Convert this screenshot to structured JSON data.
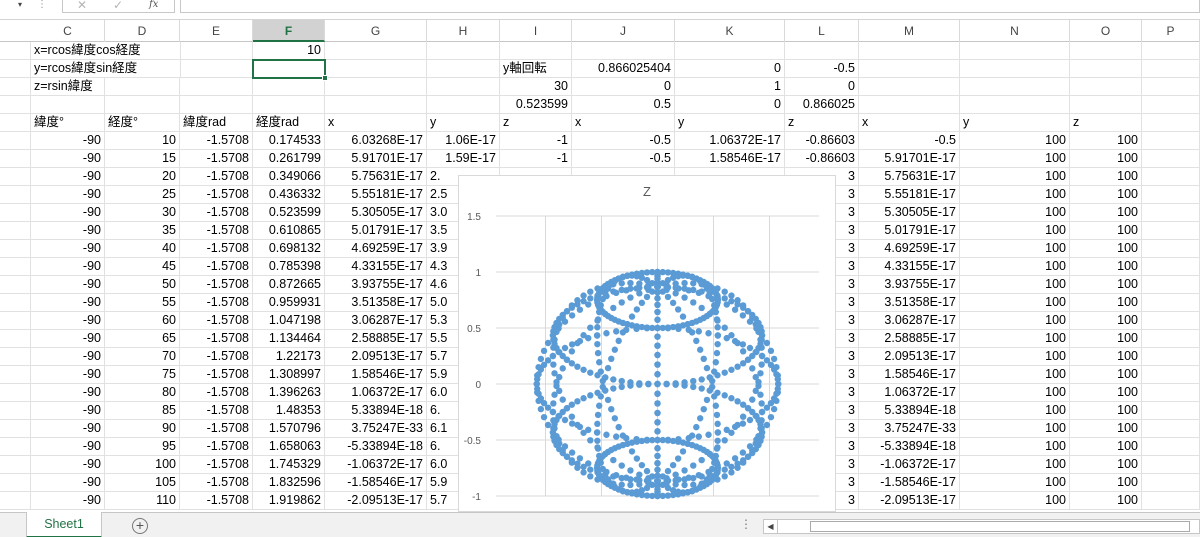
{
  "formula_bar": {
    "name_box_arrow": "▾",
    "separator": "⋮",
    "cancel_icon": "✕",
    "enter_icon": "✓",
    "fx_label": "fx",
    "formula_value": ""
  },
  "columns": [
    "C",
    "D",
    "E",
    "F",
    "G",
    "H",
    "I",
    "J",
    "K",
    "L",
    "M",
    "N",
    "O",
    "P"
  ],
  "selected_column": "F",
  "rows": [
    [
      {
        "t": "x=rcos緯度cos経度",
        "a": "l",
        "c": 0
      },
      {
        "t": "10",
        "a": "r",
        "c": 3
      }
    ],
    [
      {
        "t": "y=rcos緯度sin経度",
        "a": "l",
        "c": 0
      },
      {
        "t": "y軸回転",
        "a": "l",
        "c": 6
      },
      {
        "t": "0.866025404",
        "a": "r",
        "c": 7
      },
      {
        "t": "0",
        "a": "r",
        "c": 8
      },
      {
        "t": "-0.5",
        "a": "r",
        "c": 9
      }
    ],
    [
      {
        "t": "z=rsin緯度",
        "a": "l",
        "c": 0
      },
      {
        "t": "30",
        "a": "r",
        "c": 6
      },
      {
        "t": "0",
        "a": "r",
        "c": 7
      },
      {
        "t": "1",
        "a": "r",
        "c": 8
      },
      {
        "t": "0",
        "a": "r",
        "c": 9
      }
    ],
    [
      {
        "t": "0.523599",
        "a": "r",
        "c": 6
      },
      {
        "t": "0.5",
        "a": "r",
        "c": 7
      },
      {
        "t": "0",
        "a": "r",
        "c": 8
      },
      {
        "t": "0.866025",
        "a": "r",
        "c": 9
      }
    ],
    [
      {
        "t": "緯度°",
        "a": "l",
        "c": 0
      },
      {
        "t": "経度°",
        "a": "l",
        "c": 1
      },
      {
        "t": "緯度rad",
        "a": "l",
        "c": 2
      },
      {
        "t": "経度rad",
        "a": "l",
        "c": 3
      },
      {
        "t": "x",
        "a": "l",
        "c": 4
      },
      {
        "t": "y",
        "a": "l",
        "c": 5
      },
      {
        "t": "z",
        "a": "l",
        "c": 6
      },
      {
        "t": "x",
        "a": "l",
        "c": 7
      },
      {
        "t": "y",
        "a": "l",
        "c": 8
      },
      {
        "t": "z",
        "a": "l",
        "c": 9
      },
      {
        "t": "x",
        "a": "l",
        "c": 10
      },
      {
        "t": "y",
        "a": "l",
        "c": 11
      },
      {
        "t": "z",
        "a": "l",
        "c": 12
      }
    ],
    [
      {
        "t": "-90",
        "a": "r",
        "c": 0
      },
      {
        "t": "10",
        "a": "r",
        "c": 1
      },
      {
        "t": "-1.5708",
        "a": "r",
        "c": 2
      },
      {
        "t": "0.174533",
        "a": "r",
        "c": 3
      },
      {
        "t": "6.03268E-17",
        "a": "r",
        "c": 4
      },
      {
        "t": "1.06E-17",
        "a": "r",
        "c": 5
      },
      {
        "t": "-1",
        "a": "r",
        "c": 6
      },
      {
        "t": "-0.5",
        "a": "r",
        "c": 7
      },
      {
        "t": "1.06372E-17",
        "a": "r",
        "c": 8
      },
      {
        "t": "-0.86603",
        "a": "r",
        "c": 9
      },
      {
        "t": "-0.5",
        "a": "r",
        "c": 10
      },
      {
        "t": "100",
        "a": "r",
        "c": 11
      },
      {
        "t": "100",
        "a": "r",
        "c": 12
      }
    ],
    [
      {
        "t": "-90",
        "a": "r",
        "c": 0
      },
      {
        "t": "15",
        "a": "r",
        "c": 1
      },
      {
        "t": "-1.5708",
        "a": "r",
        "c": 2
      },
      {
        "t": "0.261799",
        "a": "r",
        "c": 3
      },
      {
        "t": "5.91701E-17",
        "a": "r",
        "c": 4
      },
      {
        "t": "1.59E-17",
        "a": "r",
        "c": 5
      },
      {
        "t": "-1",
        "a": "r",
        "c": 6
      },
      {
        "t": "-0.5",
        "a": "r",
        "c": 7
      },
      {
        "t": "1.58546E-17",
        "a": "r",
        "c": 8
      },
      {
        "t": "-0.86603",
        "a": "r",
        "c": 9
      },
      {
        "t": "5.91701E-17",
        "a": "r",
        "c": 10
      },
      {
        "t": "100",
        "a": "r",
        "c": 11
      },
      {
        "t": "100",
        "a": "r",
        "c": 12
      }
    ],
    [
      {
        "t": "-90",
        "a": "r",
        "c": 0
      },
      {
        "t": "20",
        "a": "r",
        "c": 1
      },
      {
        "t": "-1.5708",
        "a": "r",
        "c": 2
      },
      {
        "t": "0.349066",
        "a": "r",
        "c": 3
      },
      {
        "t": "5.75631E-17",
        "a": "r",
        "c": 4
      },
      {
        "t": "2.",
        "a": "l",
        "c": 5
      },
      {
        "t": "3",
        "a": "r",
        "c": 9
      },
      {
        "t": "5.75631E-17",
        "a": "r",
        "c": 10
      },
      {
        "t": "100",
        "a": "r",
        "c": 11
      },
      {
        "t": "100",
        "a": "r",
        "c": 12
      }
    ],
    [
      {
        "t": "-90",
        "a": "r",
        "c": 0
      },
      {
        "t": "25",
        "a": "r",
        "c": 1
      },
      {
        "t": "-1.5708",
        "a": "r",
        "c": 2
      },
      {
        "t": "0.436332",
        "a": "r",
        "c": 3
      },
      {
        "t": "5.55181E-17",
        "a": "r",
        "c": 4
      },
      {
        "t": "2.5",
        "a": "l",
        "c": 5
      },
      {
        "t": "3",
        "a": "r",
        "c": 9
      },
      {
        "t": "5.55181E-17",
        "a": "r",
        "c": 10
      },
      {
        "t": "100",
        "a": "r",
        "c": 11
      },
      {
        "t": "100",
        "a": "r",
        "c": 12
      }
    ],
    [
      {
        "t": "-90",
        "a": "r",
        "c": 0
      },
      {
        "t": "30",
        "a": "r",
        "c": 1
      },
      {
        "t": "-1.5708",
        "a": "r",
        "c": 2
      },
      {
        "t": "0.523599",
        "a": "r",
        "c": 3
      },
      {
        "t": "5.30505E-17",
        "a": "r",
        "c": 4
      },
      {
        "t": "3.0",
        "a": "l",
        "c": 5
      },
      {
        "t": "3",
        "a": "r",
        "c": 9
      },
      {
        "t": "5.30505E-17",
        "a": "r",
        "c": 10
      },
      {
        "t": "100",
        "a": "r",
        "c": 11
      },
      {
        "t": "100",
        "a": "r",
        "c": 12
      }
    ],
    [
      {
        "t": "-90",
        "a": "r",
        "c": 0
      },
      {
        "t": "35",
        "a": "r",
        "c": 1
      },
      {
        "t": "-1.5708",
        "a": "r",
        "c": 2
      },
      {
        "t": "0.610865",
        "a": "r",
        "c": 3
      },
      {
        "t": "5.01791E-17",
        "a": "r",
        "c": 4
      },
      {
        "t": "3.5",
        "a": "l",
        "c": 5
      },
      {
        "t": "3",
        "a": "r",
        "c": 9
      },
      {
        "t": "5.01791E-17",
        "a": "r",
        "c": 10
      },
      {
        "t": "100",
        "a": "r",
        "c": 11
      },
      {
        "t": "100",
        "a": "r",
        "c": 12
      }
    ],
    [
      {
        "t": "-90",
        "a": "r",
        "c": 0
      },
      {
        "t": "40",
        "a": "r",
        "c": 1
      },
      {
        "t": "-1.5708",
        "a": "r",
        "c": 2
      },
      {
        "t": "0.698132",
        "a": "r",
        "c": 3
      },
      {
        "t": "4.69259E-17",
        "a": "r",
        "c": 4
      },
      {
        "t": "3.9",
        "a": "l",
        "c": 5
      },
      {
        "t": "3",
        "a": "r",
        "c": 9
      },
      {
        "t": "4.69259E-17",
        "a": "r",
        "c": 10
      },
      {
        "t": "100",
        "a": "r",
        "c": 11
      },
      {
        "t": "100",
        "a": "r",
        "c": 12
      }
    ],
    [
      {
        "t": "-90",
        "a": "r",
        "c": 0
      },
      {
        "t": "45",
        "a": "r",
        "c": 1
      },
      {
        "t": "-1.5708",
        "a": "r",
        "c": 2
      },
      {
        "t": "0.785398",
        "a": "r",
        "c": 3
      },
      {
        "t": "4.33155E-17",
        "a": "r",
        "c": 4
      },
      {
        "t": "4.3",
        "a": "l",
        "c": 5
      },
      {
        "t": "3",
        "a": "r",
        "c": 9
      },
      {
        "t": "4.33155E-17",
        "a": "r",
        "c": 10
      },
      {
        "t": "100",
        "a": "r",
        "c": 11
      },
      {
        "t": "100",
        "a": "r",
        "c": 12
      }
    ],
    [
      {
        "t": "-90",
        "a": "r",
        "c": 0
      },
      {
        "t": "50",
        "a": "r",
        "c": 1
      },
      {
        "t": "-1.5708",
        "a": "r",
        "c": 2
      },
      {
        "t": "0.872665",
        "a": "r",
        "c": 3
      },
      {
        "t": "3.93755E-17",
        "a": "r",
        "c": 4
      },
      {
        "t": "4.6",
        "a": "l",
        "c": 5
      },
      {
        "t": "3",
        "a": "r",
        "c": 9
      },
      {
        "t": "3.93755E-17",
        "a": "r",
        "c": 10
      },
      {
        "t": "100",
        "a": "r",
        "c": 11
      },
      {
        "t": "100",
        "a": "r",
        "c": 12
      }
    ],
    [
      {
        "t": "-90",
        "a": "r",
        "c": 0
      },
      {
        "t": "55",
        "a": "r",
        "c": 1
      },
      {
        "t": "-1.5708",
        "a": "r",
        "c": 2
      },
      {
        "t": "0.959931",
        "a": "r",
        "c": 3
      },
      {
        "t": "3.51358E-17",
        "a": "r",
        "c": 4
      },
      {
        "t": "5.0",
        "a": "l",
        "c": 5
      },
      {
        "t": "3",
        "a": "r",
        "c": 9
      },
      {
        "t": "3.51358E-17",
        "a": "r",
        "c": 10
      },
      {
        "t": "100",
        "a": "r",
        "c": 11
      },
      {
        "t": "100",
        "a": "r",
        "c": 12
      }
    ],
    [
      {
        "t": "-90",
        "a": "r",
        "c": 0
      },
      {
        "t": "60",
        "a": "r",
        "c": 1
      },
      {
        "t": "-1.5708",
        "a": "r",
        "c": 2
      },
      {
        "t": "1.047198",
        "a": "r",
        "c": 3
      },
      {
        "t": "3.06287E-17",
        "a": "r",
        "c": 4
      },
      {
        "t": "5.3",
        "a": "l",
        "c": 5
      },
      {
        "t": "3",
        "a": "r",
        "c": 9
      },
      {
        "t": "3.06287E-17",
        "a": "r",
        "c": 10
      },
      {
        "t": "100",
        "a": "r",
        "c": 11
      },
      {
        "t": "100",
        "a": "r",
        "c": 12
      }
    ],
    [
      {
        "t": "-90",
        "a": "r",
        "c": 0
      },
      {
        "t": "65",
        "a": "r",
        "c": 1
      },
      {
        "t": "-1.5708",
        "a": "r",
        "c": 2
      },
      {
        "t": "1.134464",
        "a": "r",
        "c": 3
      },
      {
        "t": "2.58885E-17",
        "a": "r",
        "c": 4
      },
      {
        "t": "5.5",
        "a": "l",
        "c": 5
      },
      {
        "t": "3",
        "a": "r",
        "c": 9
      },
      {
        "t": "2.58885E-17",
        "a": "r",
        "c": 10
      },
      {
        "t": "100",
        "a": "r",
        "c": 11
      },
      {
        "t": "100",
        "a": "r",
        "c": 12
      }
    ],
    [
      {
        "t": "-90",
        "a": "r",
        "c": 0
      },
      {
        "t": "70",
        "a": "r",
        "c": 1
      },
      {
        "t": "-1.5708",
        "a": "r",
        "c": 2
      },
      {
        "t": "1.22173",
        "a": "r",
        "c": 3
      },
      {
        "t": "2.09513E-17",
        "a": "r",
        "c": 4
      },
      {
        "t": "5.7",
        "a": "l",
        "c": 5
      },
      {
        "t": "3",
        "a": "r",
        "c": 9
      },
      {
        "t": "2.09513E-17",
        "a": "r",
        "c": 10
      },
      {
        "t": "100",
        "a": "r",
        "c": 11
      },
      {
        "t": "100",
        "a": "r",
        "c": 12
      }
    ],
    [
      {
        "t": "-90",
        "a": "r",
        "c": 0
      },
      {
        "t": "75",
        "a": "r",
        "c": 1
      },
      {
        "t": "-1.5708",
        "a": "r",
        "c": 2
      },
      {
        "t": "1.308997",
        "a": "r",
        "c": 3
      },
      {
        "t": "1.58546E-17",
        "a": "r",
        "c": 4
      },
      {
        "t": "5.9",
        "a": "l",
        "c": 5
      },
      {
        "t": "3",
        "a": "r",
        "c": 9
      },
      {
        "t": "1.58546E-17",
        "a": "r",
        "c": 10
      },
      {
        "t": "100",
        "a": "r",
        "c": 11
      },
      {
        "t": "100",
        "a": "r",
        "c": 12
      }
    ],
    [
      {
        "t": "-90",
        "a": "r",
        "c": 0
      },
      {
        "t": "80",
        "a": "r",
        "c": 1
      },
      {
        "t": "-1.5708",
        "a": "r",
        "c": 2
      },
      {
        "t": "1.396263",
        "a": "r",
        "c": 3
      },
      {
        "t": "1.06372E-17",
        "a": "r",
        "c": 4
      },
      {
        "t": "6.0",
        "a": "l",
        "c": 5
      },
      {
        "t": "3",
        "a": "r",
        "c": 9
      },
      {
        "t": "1.06372E-17",
        "a": "r",
        "c": 10
      },
      {
        "t": "100",
        "a": "r",
        "c": 11
      },
      {
        "t": "100",
        "a": "r",
        "c": 12
      }
    ],
    [
      {
        "t": "-90",
        "a": "r",
        "c": 0
      },
      {
        "t": "85",
        "a": "r",
        "c": 1
      },
      {
        "t": "-1.5708",
        "a": "r",
        "c": 2
      },
      {
        "t": "1.48353",
        "a": "r",
        "c": 3
      },
      {
        "t": "5.33894E-18",
        "a": "r",
        "c": 4
      },
      {
        "t": "6.",
        "a": "l",
        "c": 5
      },
      {
        "t": "3",
        "a": "r",
        "c": 9
      },
      {
        "t": "5.33894E-18",
        "a": "r",
        "c": 10
      },
      {
        "t": "100",
        "a": "r",
        "c": 11
      },
      {
        "t": "100",
        "a": "r",
        "c": 12
      }
    ],
    [
      {
        "t": "-90",
        "a": "r",
        "c": 0
      },
      {
        "t": "90",
        "a": "r",
        "c": 1
      },
      {
        "t": "-1.5708",
        "a": "r",
        "c": 2
      },
      {
        "t": "1.570796",
        "a": "r",
        "c": 3
      },
      {
        "t": "3.75247E-33",
        "a": "r",
        "c": 4
      },
      {
        "t": "6.1",
        "a": "l",
        "c": 5
      },
      {
        "t": "3",
        "a": "r",
        "c": 9
      },
      {
        "t": "3.75247E-33",
        "a": "r",
        "c": 10
      },
      {
        "t": "100",
        "a": "r",
        "c": 11
      },
      {
        "t": "100",
        "a": "r",
        "c": 12
      }
    ],
    [
      {
        "t": "-90",
        "a": "r",
        "c": 0
      },
      {
        "t": "95",
        "a": "r",
        "c": 1
      },
      {
        "t": "-1.5708",
        "a": "r",
        "c": 2
      },
      {
        "t": "1.658063",
        "a": "r",
        "c": 3
      },
      {
        "t": "-5.33894E-18",
        "a": "r",
        "c": 4
      },
      {
        "t": "6.",
        "a": "l",
        "c": 5
      },
      {
        "t": "3",
        "a": "r",
        "c": 9
      },
      {
        "t": "-5.33894E-18",
        "a": "r",
        "c": 10
      },
      {
        "t": "100",
        "a": "r",
        "c": 11
      },
      {
        "t": "100",
        "a": "r",
        "c": 12
      }
    ],
    [
      {
        "t": "-90",
        "a": "r",
        "c": 0
      },
      {
        "t": "100",
        "a": "r",
        "c": 1
      },
      {
        "t": "-1.5708",
        "a": "r",
        "c": 2
      },
      {
        "t": "1.745329",
        "a": "r",
        "c": 3
      },
      {
        "t": "-1.06372E-17",
        "a": "r",
        "c": 4
      },
      {
        "t": "6.0",
        "a": "l",
        "c": 5
      },
      {
        "t": "3",
        "a": "r",
        "c": 9
      },
      {
        "t": "-1.06372E-17",
        "a": "r",
        "c": 10
      },
      {
        "t": "100",
        "a": "r",
        "c": 11
      },
      {
        "t": "100",
        "a": "r",
        "c": 12
      }
    ],
    [
      {
        "t": "-90",
        "a": "r",
        "c": 0
      },
      {
        "t": "105",
        "a": "r",
        "c": 1
      },
      {
        "t": "-1.5708",
        "a": "r",
        "c": 2
      },
      {
        "t": "1.832596",
        "a": "r",
        "c": 3
      },
      {
        "t": "-1.58546E-17",
        "a": "r",
        "c": 4
      },
      {
        "t": "5.9",
        "a": "l",
        "c": 5
      },
      {
        "t": "3",
        "a": "r",
        "c": 9
      },
      {
        "t": "-1.58546E-17",
        "a": "r",
        "c": 10
      },
      {
        "t": "100",
        "a": "r",
        "c": 11
      },
      {
        "t": "100",
        "a": "r",
        "c": 12
      }
    ],
    [
      {
        "t": "-90",
        "a": "r",
        "c": 0
      },
      {
        "t": "110",
        "a": "r",
        "c": 1
      },
      {
        "t": "-1.5708",
        "a": "r",
        "c": 2
      },
      {
        "t": "1.919862",
        "a": "r",
        "c": 3
      },
      {
        "t": "-2.09513E-17",
        "a": "r",
        "c": 4
      },
      {
        "t": "5.7",
        "a": "l",
        "c": 5
      },
      {
        "t": "3",
        "a": "r",
        "c": 9
      },
      {
        "t": "-2.09513E-17",
        "a": "r",
        "c": 10
      },
      {
        "t": "100",
        "a": "r",
        "c": 11
      },
      {
        "t": "100",
        "a": "r",
        "c": 12
      }
    ]
  ],
  "chart_data": {
    "type": "scatter",
    "title": "Z",
    "xlabel": "",
    "ylabel": "",
    "ylim": [
      -1,
      1.5
    ],
    "y_ticks": [
      "1.5",
      "1",
      "0.5",
      "0",
      "-0.5",
      "-1"
    ],
    "grid": true,
    "marker_color": "#5b9bd5",
    "series": [
      {
        "description": "sphere wireframe projected after 30° rotation about y axis",
        "latitudes_deg": [
          -90,
          -60,
          -30,
          0,
          30,
          60
        ],
        "longitudes_deg_step": 5,
        "meridians_deg": [
          0,
          30,
          60,
          90,
          120,
          150,
          180,
          210,
          240,
          270,
          300,
          330
        ],
        "rotation_deg": 30,
        "view": "x-z"
      }
    ]
  },
  "sheet_tabs": {
    "active": "Sheet1",
    "add_label": "+",
    "dots": "⋮",
    "scroll_left": "◀"
  }
}
